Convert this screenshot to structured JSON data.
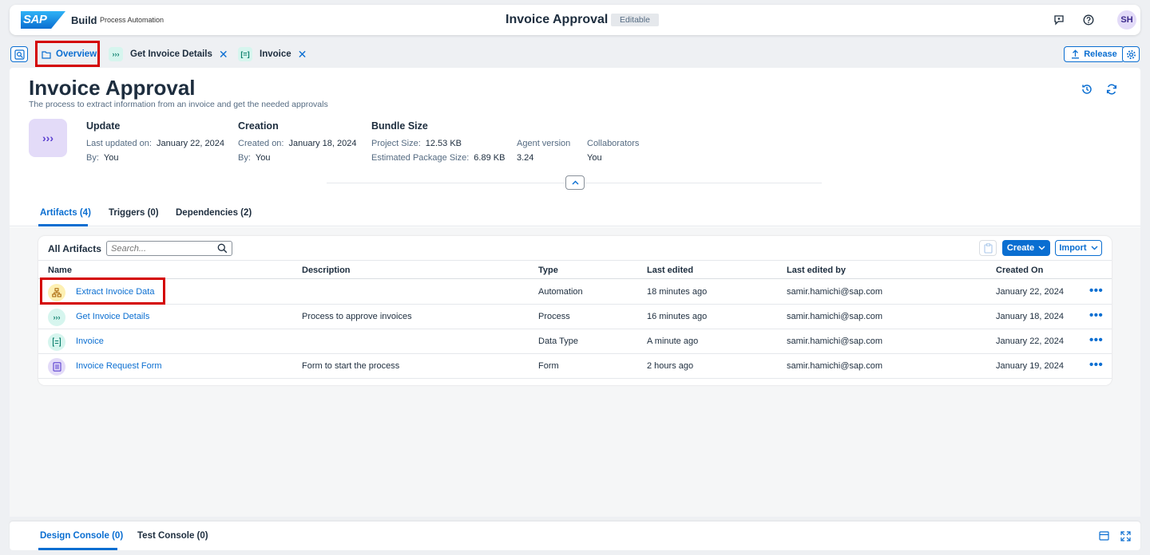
{
  "shell": {
    "logo": "SAP",
    "brand": "Build",
    "brand_sub": "Process Automation",
    "title": "Invoice Approval",
    "badge": "Editable",
    "avatar": "SH"
  },
  "tabs": [
    {
      "label": "Overview",
      "icon": "folder-icon"
    },
    {
      "label": "Get Invoice Details",
      "icon": "process-icon"
    },
    {
      "label": "Invoice",
      "icon": "data-type-icon"
    }
  ],
  "toolbar": {
    "release_label": "Release"
  },
  "header": {
    "title": "Invoice Approval",
    "subtitle": "The process to extract information from an invoice and get the needed approvals"
  },
  "meta": {
    "update": {
      "title": "Update",
      "last_updated_key": "Last updated on:",
      "last_updated_val": "January 22, 2024",
      "by_key": "By:",
      "by_val": "You"
    },
    "creation": {
      "title": "Creation",
      "created_key": "Created on:",
      "created_val": "January 18, 2024",
      "by_key": "By:",
      "by_val": "You"
    },
    "bundle": {
      "title": "Bundle Size",
      "project_key": "Project Size:",
      "project_val": "12.53 KB",
      "package_key": "Estimated Package Size:",
      "package_val": "6.89 KB"
    },
    "agent": {
      "key": "Agent version",
      "val": "3.24"
    },
    "collaborators": {
      "key": "Collaborators",
      "val": "You"
    }
  },
  "section_tabs": [
    "Artifacts (4)",
    "Triggers (0)",
    "Dependencies (2)"
  ],
  "artifacts": {
    "title": "All Artifacts",
    "search_placeholder": "Search...",
    "create_label": "Create",
    "import_label": "Import",
    "columns": [
      "Name",
      "Description",
      "Type",
      "Last edited",
      "Last edited by",
      "Created On"
    ],
    "rows": [
      {
        "name": "Extract Invoice Data",
        "description": "",
        "type": "Automation",
        "last_edited": "18 minutes ago",
        "edited_by": "samir.hamichi@sap.com",
        "created_on": "January 22, 2024",
        "icon": "automation-icon",
        "icon_bg": "#fdf0b3",
        "icon_fg": "#a55f00"
      },
      {
        "name": "Get Invoice Details",
        "description": "Process to approve invoices",
        "type": "Process",
        "last_edited": "16 minutes ago",
        "edited_by": "samir.hamichi@sap.com",
        "created_on": "January 18, 2024",
        "icon": "process-icon",
        "icon_bg": "#d6f5ee",
        "icon_fg": "#0a7e6b"
      },
      {
        "name": "Invoice",
        "description": "",
        "type": "Data Type",
        "last_edited": "A minute ago",
        "edited_by": "samir.hamichi@sap.com",
        "created_on": "January 22, 2024",
        "icon": "data-type-icon",
        "icon_bg": "#d6f5ee",
        "icon_fg": "#0a7e6b"
      },
      {
        "name": "Invoice Request Form",
        "description": "Form to start the process",
        "type": "Form",
        "last_edited": "2 hours ago",
        "edited_by": "samir.hamichi@sap.com",
        "created_on": "January 19, 2024",
        "icon": "form-icon",
        "icon_bg": "#e3dbf8",
        "icon_fg": "#5a3fd0"
      }
    ]
  },
  "console": {
    "design": "Design Console (0)",
    "test": "Test Console (0)"
  },
  "colors": {
    "accent": "#0a6ed1",
    "highlight": "#d40000"
  }
}
